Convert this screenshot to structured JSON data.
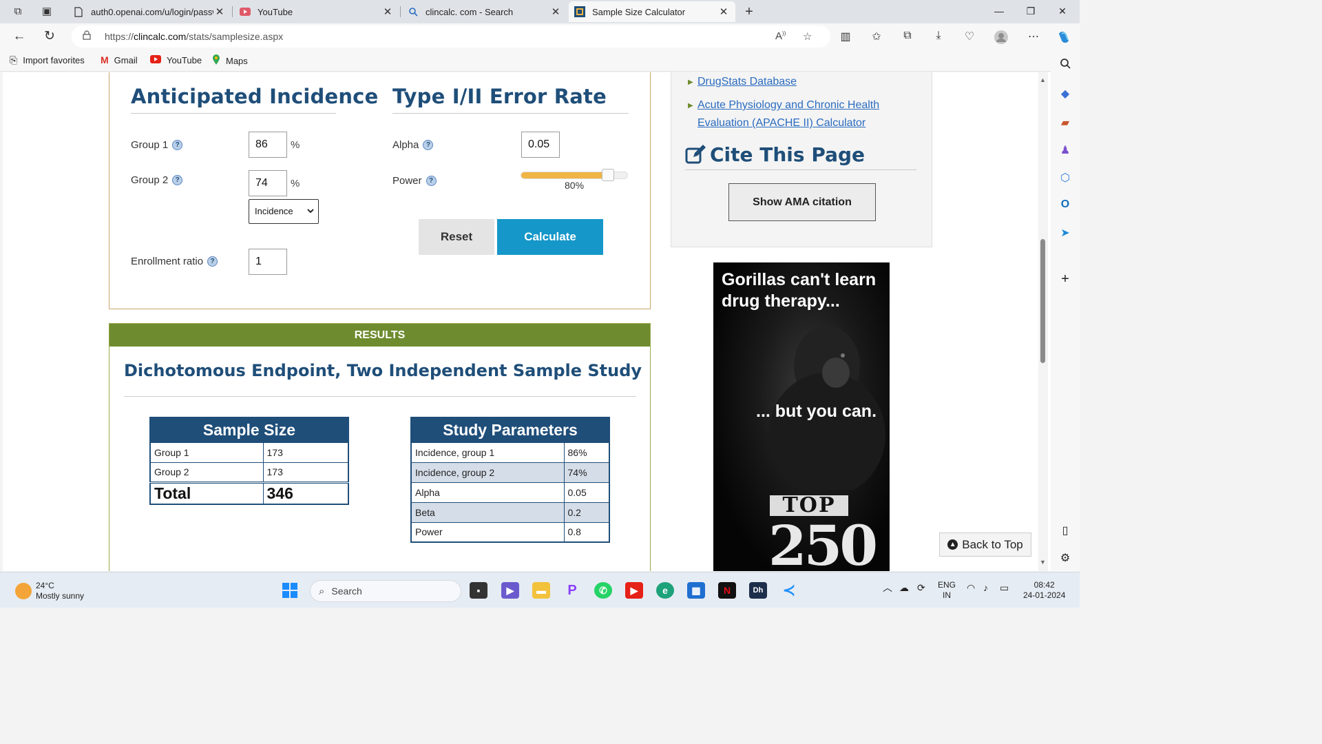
{
  "browser": {
    "tabs": [
      {
        "title": "auth0.openai.com/u/login/passw",
        "icon": "page-icon",
        "active": false
      },
      {
        "title": "YouTube",
        "icon": "youtube-icon",
        "active": false
      },
      {
        "title": "clincalc. com - Search",
        "icon": "search-icon",
        "active": false
      },
      {
        "title": "Sample Size Calculator",
        "icon": "clincalc-icon",
        "active": true
      }
    ],
    "address": {
      "url_prefix": "https://",
      "url_host": "clincalc.com",
      "url_path": "/stats/samplesize.aspx"
    },
    "favorites": [
      {
        "label": "Import favorites",
        "icon": "import-icon"
      },
      {
        "label": "Gmail",
        "icon": "gmail-icon"
      },
      {
        "label": "YouTube",
        "icon": "youtube-icon"
      },
      {
        "label": "Maps",
        "icon": "maps-icon"
      }
    ]
  },
  "calculator": {
    "incidence_title": "Anticipated Incidence",
    "error_title": "Type I/II Error Rate",
    "group1_label": "Group 1",
    "group1_value": "86",
    "group2_label": "Group 2",
    "group2_value": "74",
    "percent_sign": "%",
    "select_value": "Incidence",
    "enrollment_label": "Enrollment ratio",
    "enrollment_value": "1",
    "alpha_label": "Alpha",
    "alpha_value": "0.05",
    "power_label": "Power",
    "power_value": "80%",
    "power_fraction": 0.8,
    "reset_label": "Reset",
    "calculate_label": "Calculate",
    "help_glyph": "?"
  },
  "results": {
    "header": "RESULTS",
    "title": "Dichotomous Endpoint, Two Independent Sample Study",
    "sample_size": {
      "heading": "Sample Size",
      "rows": [
        {
          "label": "Group 1",
          "value": "173"
        },
        {
          "label": "Group 2",
          "value": "173"
        }
      ],
      "total_label": "Total",
      "total_value": "346"
    },
    "study_parameters": {
      "heading": "Study Parameters",
      "rows": [
        {
          "label": "Incidence, group 1",
          "value": "86%"
        },
        {
          "label": "Incidence, group 2",
          "value": "74%"
        },
        {
          "label": "Alpha",
          "value": "0.05"
        },
        {
          "label": "Beta",
          "value": "0.2"
        },
        {
          "label": "Power",
          "value": "0.8"
        }
      ]
    }
  },
  "sidebar": {
    "links": [
      "DrugStats Database",
      "Acute Physiology and Chronic Health",
      "Evaluation (APACHE II) Calculator"
    ],
    "cite_title": "Cite This Page",
    "ama_button": "Show AMA citation",
    "back_to_top": "Back to Top"
  },
  "ad": {
    "line1": "Gorillas can't learn drug therapy...",
    "line2": "... but you can.",
    "badge_top": "TOP",
    "badge_num": "250"
  },
  "taskbar": {
    "weather_temp": "24°C",
    "weather_desc": "Mostly sunny",
    "search_placeholder": "Search",
    "lang": "ENG",
    "region": "IN",
    "time": "08:42",
    "date": "24-01-2024"
  },
  "colors": {
    "accent_blue": "#1f4e79",
    "calculate_button": "#1597c9",
    "results_header": "#6e8c2f",
    "slider_fill": "#f0b545"
  }
}
